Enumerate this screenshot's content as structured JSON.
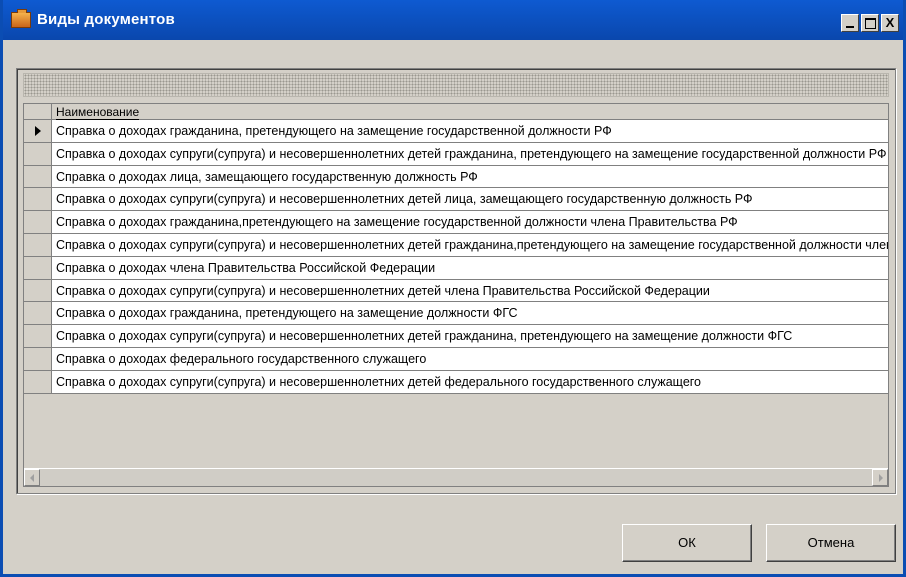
{
  "window": {
    "title": "Виды документов",
    "icon": "briefcase-icon",
    "minimize_label": "",
    "close_label": "X"
  },
  "grid": {
    "column_header": "Наименование",
    "selected_row": 0,
    "rows": [
      "Справка о доходах гражданина, претендующего на замещение государственной должности РФ",
      "Справка о доходах супруги(супруга) и несовершеннолетних детей  гражданина, претендующего на замещение государственной должности РФ",
      "Справка о доходах лица, замещающего государственную должность РФ",
      "Справка о доходах  супруги(супруга) и несовершеннолетних детей лица, замещающего государственную должность РФ",
      "Справка о доходах гражданина,претендующего на замещение государственной должности члена Правительства РФ",
      "Справка о доходах  супруги(супруга) и несовершеннолетних детей гражданина,претендующего на замещение государственной должности члена Правительства РФ",
      "Справка о доходах члена Правительства Российской Федерации",
      "Справка о доходах супруги(супруга) и несовершеннолетних детей члена Правительства Российской Федерации",
      "Справка о доходах гражданина, претендующего на замещение должности ФГС",
      "Справка о доходах супруги(супруга) и несовершеннолетних детей гражданина, претендующего на замещение должности ФГС",
      "Справка о доходах федерального государственного служащего",
      "Справка о доходах супруги(супруга) и несовершеннолетних детей федерального государственного служащего"
    ]
  },
  "buttons": {
    "ok_label": "ОК",
    "cancel_label": "Отмена"
  },
  "colors": {
    "titlebar": "#0a47ad",
    "face": "#d4d0c8",
    "cell": "#ffffff"
  }
}
